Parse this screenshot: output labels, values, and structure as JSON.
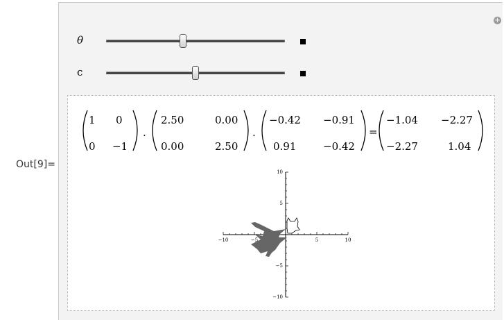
{
  "output_label": "Out[9]=",
  "controls": {
    "theta": {
      "label": "θ",
      "value": 0.43
    },
    "c": {
      "label": "c",
      "value": 0.5
    }
  },
  "equation": {
    "reflection": [
      [
        "1",
        "0"
      ],
      [
        "0",
        "−1"
      ]
    ],
    "scale": [
      [
        "2.50",
        "0.00"
      ],
      [
        "0.00",
        "2.50"
      ]
    ],
    "rotation": [
      [
        "−0.42",
        "−0.91"
      ],
      [
        "0.91",
        "−0.42"
      ]
    ],
    "result": [
      [
        "−1.04",
        "−2.27"
      ],
      [
        "−2.27",
        "1.04"
      ]
    ],
    "dot_symbol": ".",
    "equals_symbol": "="
  },
  "plot": {
    "x_ticks": [
      "−10",
      "−5",
      "5",
      "10"
    ],
    "y_ticks": [
      "10",
      "5",
      "−5",
      "−10"
    ],
    "xlim": [
      -10,
      10
    ],
    "ylim": [
      -10,
      10
    ],
    "shape_color": "#666666"
  },
  "icons": {
    "plus": "+"
  }
}
